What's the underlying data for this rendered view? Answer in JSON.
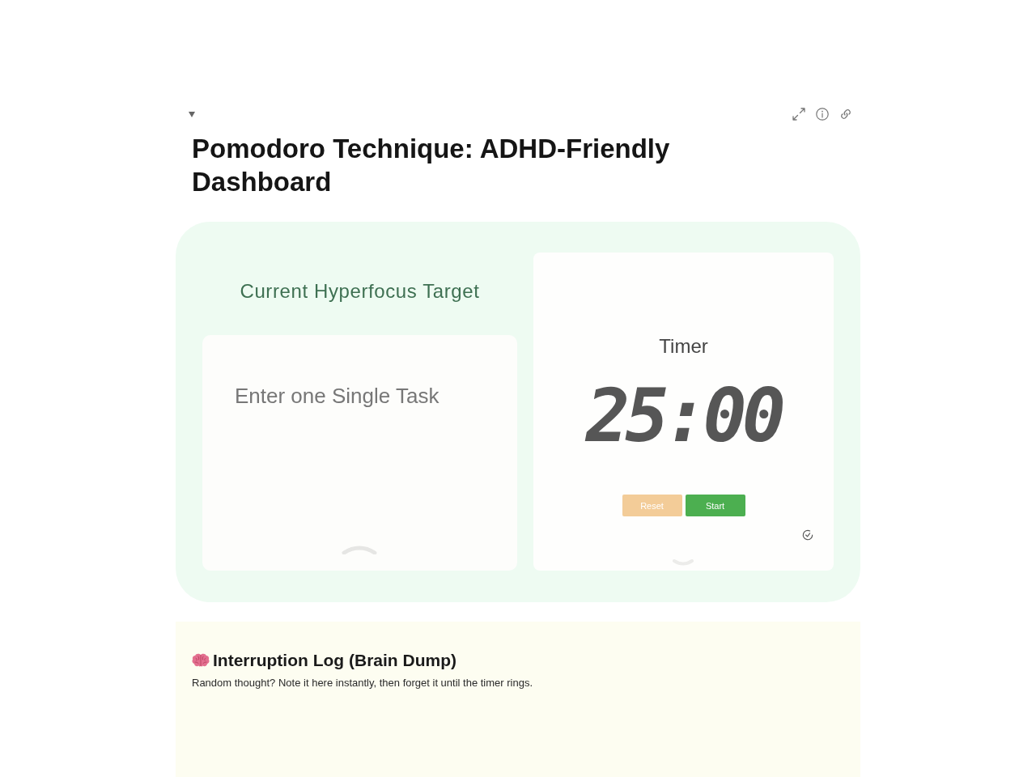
{
  "block": {
    "expanded": true,
    "title": "Pomodoro Technique: ADHD-Friendly Dashboard"
  },
  "focus_panel": {
    "heading": "Current Hyperfocus Target",
    "task_input": {
      "placeholder": "Enter one Single Task"
    }
  },
  "timer": {
    "label": "Timer",
    "time": "25:00",
    "buttons": [
      {
        "label": "Reset",
        "kind": "reset"
      },
      {
        "label": "Start",
        "kind": "start"
      }
    ]
  },
  "interruption_log": {
    "heading": "Interruption Log (Brain Dump)",
    "description": "Random thought? Note it here instantly, then forget it until the timer rings."
  }
}
